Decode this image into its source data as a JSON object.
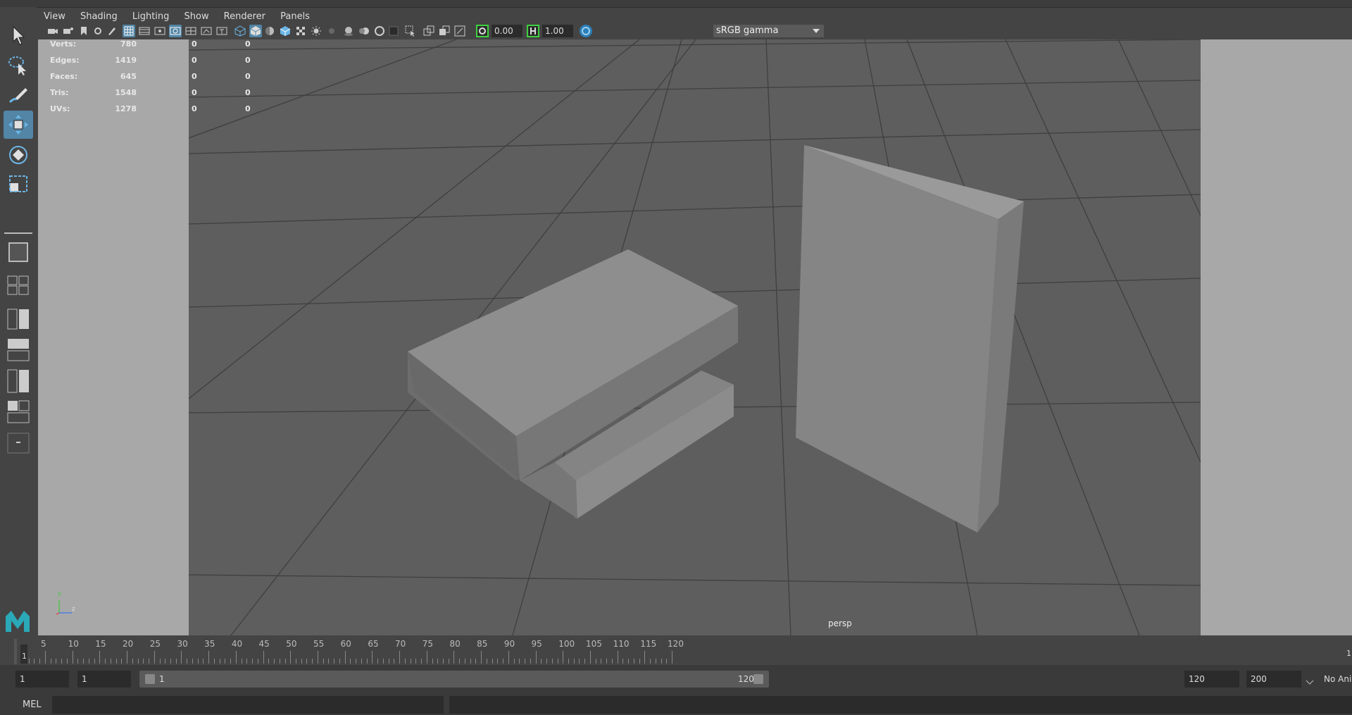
{
  "panel_menu": [
    "View",
    "Shading",
    "Lighting",
    "Show",
    "Renderer",
    "Panels"
  ],
  "toolbar": {
    "exposure_value": "0.00",
    "gamma_value": "1.00",
    "color_space": "sRGB gamma"
  },
  "hud": {
    "rows": [
      {
        "label": "Verts:",
        "v1": "780",
        "v2": "0",
        "v3": "0"
      },
      {
        "label": "Edges:",
        "v1": "1419",
        "v2": "0",
        "v3": "0"
      },
      {
        "label": "Faces:",
        "v1": "645",
        "v2": "0",
        "v3": "0"
      },
      {
        "label": "Tris:",
        "v1": "1548",
        "v2": "0",
        "v3": "0"
      },
      {
        "label": "UVs:",
        "v1": "1278",
        "v2": "0",
        "v3": "0"
      }
    ]
  },
  "viewport": {
    "camera_label": "persp",
    "axis_y": "y",
    "axis_z": "z"
  },
  "time_slider": {
    "current_frame": "1",
    "labels": [
      "5",
      "10",
      "15",
      "20",
      "25",
      "30",
      "35",
      "40",
      "45",
      "50",
      "55",
      "60",
      "65",
      "70",
      "75",
      "80",
      "85",
      "90",
      "95",
      "100",
      "105",
      "110",
      "115",
      "120"
    ],
    "end_marker": "1"
  },
  "range_slider": {
    "start_time": "1",
    "playback_start": "1",
    "bar_start": "1",
    "bar_end": "120",
    "playback_end": "120",
    "end_time": "200",
    "anim_layer": "No Anim"
  },
  "command_line": {
    "language": "MEL"
  },
  "colors": {
    "accent": "#5285a6",
    "viewport_bg": "#5e5e5e",
    "panel_bg": "#444444"
  },
  "icons": {
    "select_tool": "arrow-icon",
    "lasso_tool": "lasso-icon",
    "paint_tool": "paint-select-icon",
    "move_tool": "move-icon",
    "rotate_tool": "rotate-icon",
    "scale_tool": "scale-icon",
    "maya_logo": "maya-logo-icon"
  }
}
